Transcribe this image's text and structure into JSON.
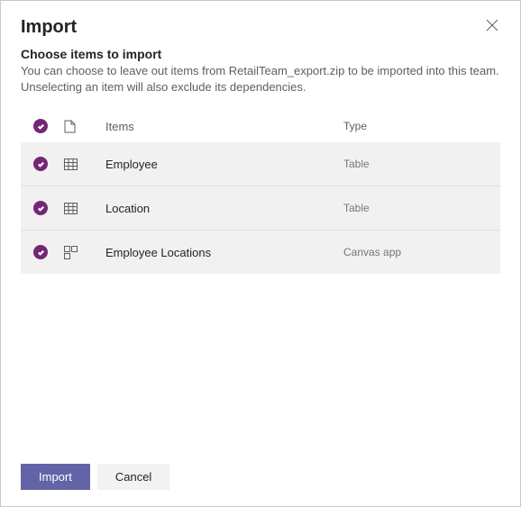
{
  "dialog": {
    "title": "Import",
    "subtitle": "Choose items to import",
    "description": "You can choose to leave out items from RetailTeam_export.zip to be imported into this team. Unselecting an item will also exclude its dependencies."
  },
  "table": {
    "columns": {
      "items": "Items",
      "type": "Type"
    },
    "rows": [
      {
        "name": "Employee",
        "type": "Table",
        "icon": "table"
      },
      {
        "name": "Location",
        "type": "Table",
        "icon": "table"
      },
      {
        "name": "Employee Locations",
        "type": "Canvas app",
        "icon": "app"
      }
    ]
  },
  "footer": {
    "primary": "Import",
    "secondary": "Cancel"
  }
}
